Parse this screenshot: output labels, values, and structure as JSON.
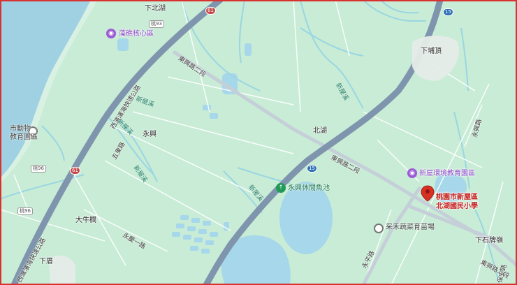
{
  "map": {
    "places": {
      "xiabeihu": "下北湖",
      "xiapuding": "下埔頂",
      "beihu": "北湖",
      "yongxing": "永興",
      "daniulan": "大牛欄",
      "xiacuo": "下厝",
      "xiashiduling": "下石牌嶺"
    },
    "pois": {
      "zaojiao": "藻礁核心區",
      "zoo": [
        "市動物",
        "教育園區"
      ],
      "xinwu_env": "新屋環境教育園區",
      "leisure_fishpond": "永興休閒魚池",
      "nursery": "采禾蔬菜育苗場"
    },
    "pin": {
      "line1": "桃園市新屋區",
      "line2": "北湖國民小學",
      "color": "#d93025"
    },
    "roads": {
      "dongxing_top": "東興路二段",
      "dongxing_right": "東興路二段",
      "dongxing_bottom": "東興路二段",
      "expressway_top": "西濱濱海快速公路",
      "expressway_bottom": "西濱濱海快速公路",
      "wuzhuang": "五東路",
      "yongqing": "永慶一路",
      "yongping": "永平路",
      "lean": "保安路",
      "yongxing_rd": "永興路"
    },
    "waterways": {
      "a": "新屋溪",
      "b": "新屋溪",
      "c": "新屋溪",
      "d": "新屋溪",
      "e": "新屋溪"
    },
    "shields": {
      "s61_top": "61",
      "s61_mid": "61",
      "s15_top": "15",
      "s15_mid": "15",
      "b93": "桃93",
      "b96": "桃96",
      "b96b": "桃96"
    },
    "colors": {
      "land": "#c8ecd6",
      "sea": "#9fd1e3",
      "expressway": "#7f95ad",
      "highway": "#a7b6c6",
      "local_road": "#ffffff",
      "river": "#9ad6e2",
      "pond": "#a7d7ea",
      "frame": "#d93030"
    }
  }
}
